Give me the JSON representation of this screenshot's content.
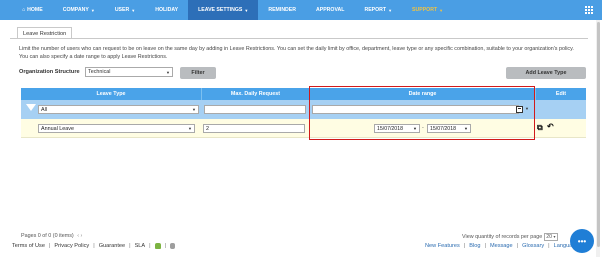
{
  "nav": {
    "home": "HOME",
    "company": "COMPANY",
    "user": "USER",
    "holiday": "HOLIDAY",
    "leave_settings": "LEAVE SETTINGS",
    "reminder": "REMINDER",
    "approval": "APPROVAL",
    "report": "REPORT",
    "support": "SUPPORT",
    "active_color": "#2d6fb8",
    "bar_color": "#4a9ee4",
    "support_color": "#f1c340"
  },
  "tab": {
    "label": "Leave Restriction"
  },
  "description": "Limit the number of users who can request to be on leave on the same day by adding in Leave Restrictions. You can set the daily limit by office, department, leave type or any specific combination, suitable to your organization's policy. You can also specify a date range to apply Leave Restrictions.",
  "filters": {
    "org_structure_label": "Organization Structure",
    "org_structure_value": "Technical",
    "filter_button": "Filter",
    "add_button": "Add Leave Type"
  },
  "table": {
    "headers": {
      "leave_type": "Leave Type",
      "max_daily": "Max. Daily Request",
      "date_range": "Date range",
      "edit": "Edit"
    },
    "filter_row": {
      "leave_type": "All",
      "max_daily": "",
      "date_range": ""
    },
    "rows": [
      {
        "leave_type": "Annual Leave",
        "max_daily": "2",
        "date_from": "15/07/2018",
        "date_to": "15/07/2018",
        "date_separator": "-"
      }
    ]
  },
  "pager": {
    "text": "Pages 0 of 0 (0 items)",
    "arrows": "‹ ›",
    "view_qty_label": "View quantity of records per page",
    "view_qty_value": "20"
  },
  "footer": {
    "terms": "Terms of Use",
    "privacy": "Privacy Policy",
    "guarantee": "Guarantee",
    "sla": "SLA",
    "new_features": "New Features",
    "blog": "Blog",
    "message": "Message",
    "glossary": "Glossary",
    "language": "Language"
  },
  "highlight_color": "#d11a1a"
}
